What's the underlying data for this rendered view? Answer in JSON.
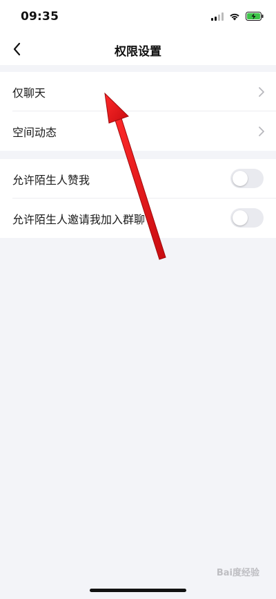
{
  "status_bar": {
    "time": "09:35",
    "icons": [
      "signal-icon",
      "wifi-icon",
      "battery-charging-icon"
    ]
  },
  "nav": {
    "title": "权限设置",
    "back_icon": "back-chevron-icon"
  },
  "section_privacy": {
    "items": [
      {
        "label": "仅聊天",
        "icon": "chevron-right-icon"
      },
      {
        "label": "空间动态",
        "icon": "chevron-right-icon"
      }
    ]
  },
  "section_strangers": {
    "items": [
      {
        "label": "允许陌生人赞我",
        "toggle": false
      },
      {
        "label": "允许陌生人邀请我加入群聊",
        "toggle": false
      }
    ]
  },
  "overlay": {
    "arrow_color": "#e8141a"
  },
  "watermark": {
    "text": "Bai度经验"
  }
}
